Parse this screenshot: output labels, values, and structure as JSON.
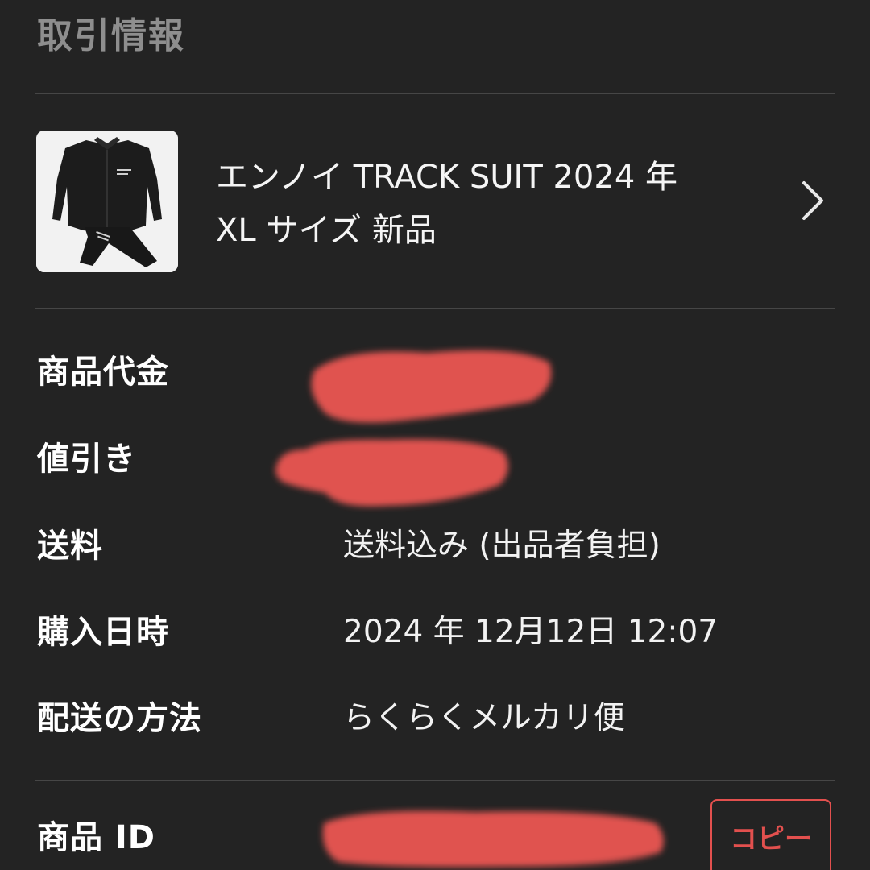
{
  "header": {
    "title": "取引情報"
  },
  "product": {
    "title_line1": "エンノイ TRACK SUIT 2024 年",
    "title_line2": "XL サイズ 新品",
    "thumbnail_icon": "jacket-image"
  },
  "rows": [
    {
      "label": "商品代金",
      "value": ""
    },
    {
      "label": "値引き",
      "value": ""
    },
    {
      "label": "送料",
      "value": "送料込み (出品者負担)"
    },
    {
      "label": "購入日時",
      "value": "2024 年 12月12日 12:07"
    },
    {
      "label": "配送の方法",
      "value": "らくらくメルカリ便"
    },
    {
      "label": "商品 ID",
      "value": ""
    }
  ],
  "copy_button": {
    "label": "コピー"
  },
  "colors": {
    "background": "#232323",
    "divider": "#464646",
    "accent": "#e2504e",
    "redaction": "#e05250"
  }
}
